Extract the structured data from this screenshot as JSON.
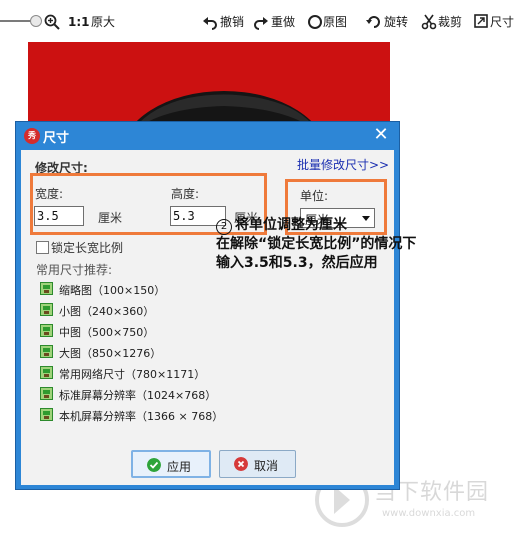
{
  "toolbar": {
    "zoom_ratio": "1:1",
    "original_size": "原大",
    "undo": "撤销",
    "redo": "重做",
    "original_image": "原图",
    "rotate": "旋转",
    "crop": "裁剪",
    "size": "尺寸"
  },
  "dialog": {
    "title": "尺寸",
    "logo_text": "秀",
    "close": "✕",
    "section_title": "修改尺寸:",
    "batch_link": "批量修改尺寸>>",
    "width_label": "宽度:",
    "width_value": "3.5",
    "height_label": "高度:",
    "height_value": "5.3",
    "unit_text_width": "厘米",
    "unit_text_height": "厘米",
    "unit_label": "单位:",
    "unit_selected": "厘米",
    "lock_ratio_label": "锁定长宽比例",
    "lock_ratio_checked": false,
    "recommend_title": "常用尺寸推荐:",
    "presets": [
      {
        "label": "缩略图（100×150）"
      },
      {
        "label": "小图（240×360）"
      },
      {
        "label": "中图（500×750）"
      },
      {
        "label": "大图（850×1276）"
      },
      {
        "label": "常用网络尺寸（780×1171）"
      },
      {
        "label": "标准屏幕分辨率（1024×768）"
      },
      {
        "label": "本机屏幕分辨率（1366 × 768）"
      }
    ],
    "apply_button": "应用",
    "cancel_button": "取消"
  },
  "annotation": {
    "number": "2",
    "line1": "将单位调整为厘米",
    "line2": "在解除“锁定长宽比例”的情况下",
    "line3": "输入3.5和5.3，然后应用"
  },
  "watermark": {
    "name": "当下软件园",
    "url": "www.downxia.com"
  },
  "colors": {
    "photo_background": "#cc1111",
    "dialog_frame": "#2d86d6",
    "highlight_box": "#ef7a3b",
    "link": "#1b2fb1"
  }
}
